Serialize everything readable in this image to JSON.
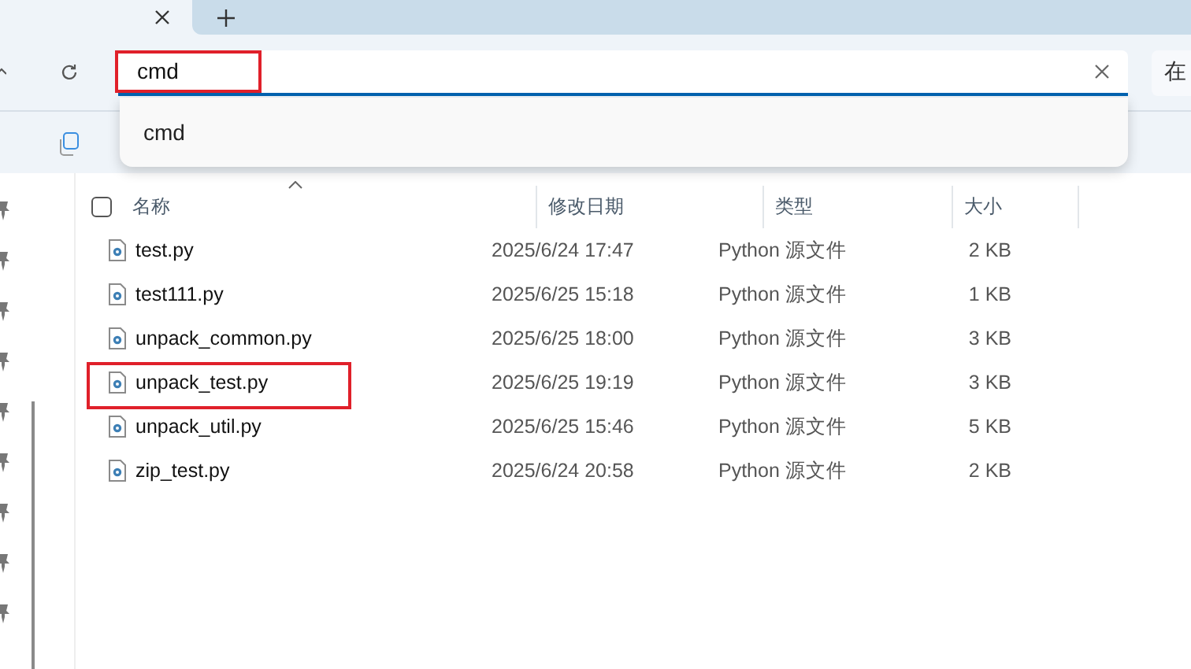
{
  "address_bar": {
    "value": "cmd",
    "annotated": true
  },
  "search_field": {
    "placeholder": "在"
  },
  "suggestions": [
    {
      "label": "cmd"
    }
  ],
  "table": {
    "select_all": {
      "checked": false
    },
    "columns": [
      {
        "label": "名称",
        "sorted": true
      },
      {
        "label": "修改日期",
        "sorted": false
      },
      {
        "label": "类型",
        "sorted": false
      },
      {
        "label": "大小",
        "sorted": false
      }
    ],
    "rows": [
      {
        "name": "test.py",
        "date": "2025/6/24 17:47",
        "type": "Python 源文件",
        "size": "2 KB",
        "annotated": false
      },
      {
        "name": "test111.py",
        "date": "2025/6/25 15:18",
        "type": "Python 源文件",
        "size": "1 KB",
        "annotated": false
      },
      {
        "name": "unpack_common.py",
        "date": "2025/6/25 18:00",
        "type": "Python 源文件",
        "size": "3 KB",
        "annotated": false
      },
      {
        "name": "unpack_test.py",
        "date": "2025/6/25 19:19",
        "type": "Python 源文件",
        "size": "3 KB",
        "annotated": true
      },
      {
        "name": "unpack_util.py",
        "date": "2025/6/25 15:46",
        "type": "Python 源文件",
        "size": "5 KB",
        "annotated": false
      },
      {
        "name": "zip_test.py",
        "date": "2025/6/24 20:58",
        "type": "Python 源文件",
        "size": "2 KB",
        "annotated": false
      }
    ]
  }
}
